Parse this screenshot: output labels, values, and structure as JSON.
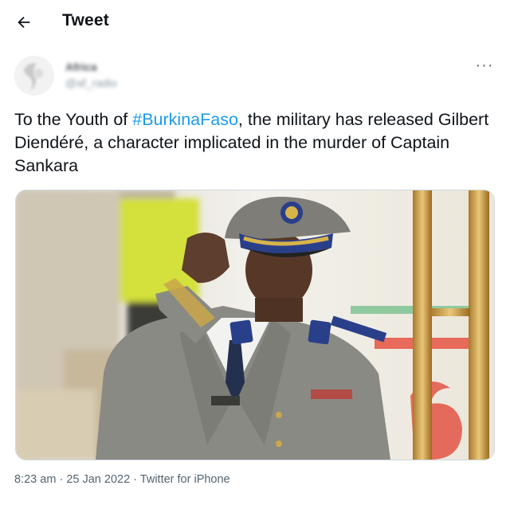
{
  "header": {
    "title": "Tweet",
    "back_icon": "arrow-left-icon"
  },
  "author": {
    "name": "Africa",
    "handle": "@af_radio",
    "more_icon": "more-options-icon",
    "more_label": "···"
  },
  "tweet": {
    "text_before_hashtag": "To the Youth of ",
    "hashtag": "#BurkinaFaso",
    "text_after_hashtag": ", the military has released Gilbert Diendéré, a character implicated in the murder of Captain Sankara"
  },
  "media": {
    "alt": "Photo of a man in military uniform saluting"
  },
  "meta": {
    "time": "8:23 am",
    "separator": "·",
    "date": "25 Jan 2022",
    "source": "Twitter for iPhone"
  },
  "colors": {
    "hashtag": "#1d9bf0",
    "text": "#0f1419",
    "secondary": "#536471",
    "border": "#cfd9de"
  }
}
